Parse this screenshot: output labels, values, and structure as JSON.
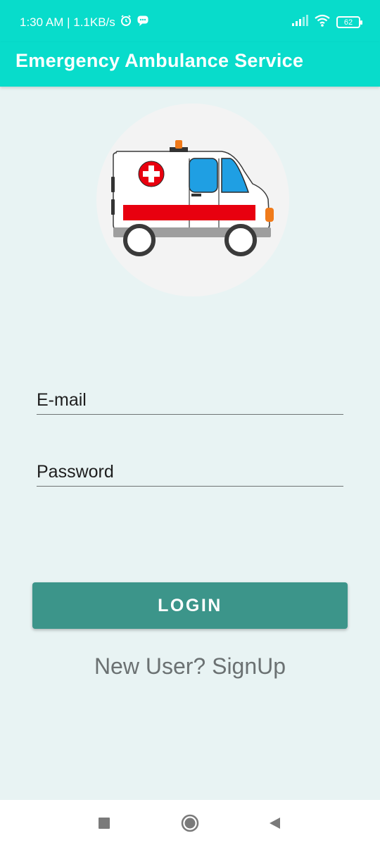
{
  "status_bar": {
    "time_and_speed": "1:30 AM | 1.1KB/s",
    "battery_level": "62"
  },
  "app_bar": {
    "title": "Emergency Ambulance Service"
  },
  "hero": {
    "icon": "ambulance-icon"
  },
  "form": {
    "email_placeholder": "E-mail",
    "email_value": "",
    "password_placeholder": "Password",
    "password_value": ""
  },
  "actions": {
    "login_label": "LOGIN",
    "signup_label": "New User? SignUp"
  },
  "nav_bar": {
    "recents_icon": "square-recents-icon",
    "home_icon": "circle-home-icon",
    "back_icon": "triangle-back-icon"
  },
  "colors": {
    "accent": "#08dccb",
    "primary_button": "#3c958a",
    "background": "#e8f3f3",
    "ambulance_red": "#e8000f",
    "ambulance_blue": "#1f9fe3"
  }
}
